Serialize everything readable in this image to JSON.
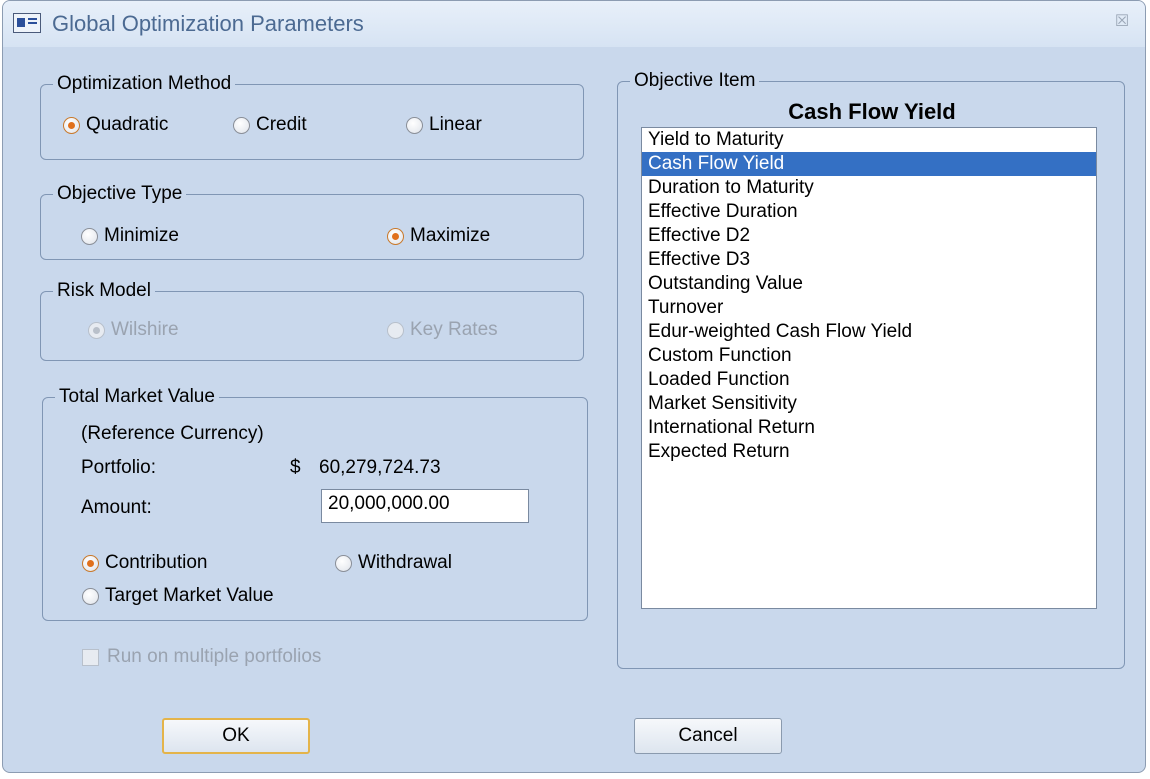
{
  "window": {
    "title": "Global Optimization Parameters",
    "close_glyph": "☒"
  },
  "optimization_method": {
    "legend": "Optimization Method",
    "options": [
      {
        "label": "Quadratic",
        "selected": true
      },
      {
        "label": "Credit",
        "selected": false
      },
      {
        "label": "Linear",
        "selected": false
      }
    ]
  },
  "objective_type": {
    "legend": "Objective Type",
    "options": [
      {
        "label": "Minimize",
        "selected": false
      },
      {
        "label": "Maximize",
        "selected": true
      }
    ]
  },
  "risk_model": {
    "legend": "Risk Model",
    "options": [
      {
        "label": "Wilshire",
        "selected": true,
        "disabled": true
      },
      {
        "label": "Key Rates",
        "selected": false,
        "disabled": true
      }
    ]
  },
  "total_market_value": {
    "legend": "Total Market Value",
    "reference_currency": "(Reference Currency)",
    "portfolio_label": "Portfolio:",
    "currency_symbol": "$",
    "portfolio_value": "60,279,724.73",
    "amount_label": "Amount:",
    "amount_value": "20,000,000.00",
    "options": [
      {
        "label": "Contribution",
        "selected": true
      },
      {
        "label": "Withdrawal",
        "selected": false
      },
      {
        "label": "Target Market Value",
        "selected": false
      }
    ]
  },
  "run_multiple": {
    "label": "Run on multiple portfolios",
    "checked": false,
    "disabled": true
  },
  "objective_item": {
    "legend": "Objective Item",
    "selected_heading": "Cash Flow Yield",
    "items": [
      "Yield to Maturity",
      "Cash Flow Yield",
      "Duration to Maturity",
      "Effective Duration",
      "Effective D2",
      "Effective D3",
      "Outstanding Value",
      "Turnover",
      "Edur-weighted Cash Flow Yield",
      "Custom Function",
      "Loaded Function",
      "Market Sensitivity",
      "International Return",
      "Expected Return"
    ],
    "selected_index": 1
  },
  "buttons": {
    "ok": "OK",
    "cancel": "Cancel"
  },
  "colors": {
    "window_bg": "#c9d8ec",
    "selection": "#3470c4",
    "radio_checked": "#e0701c",
    "title_text": "#4c6a92"
  }
}
